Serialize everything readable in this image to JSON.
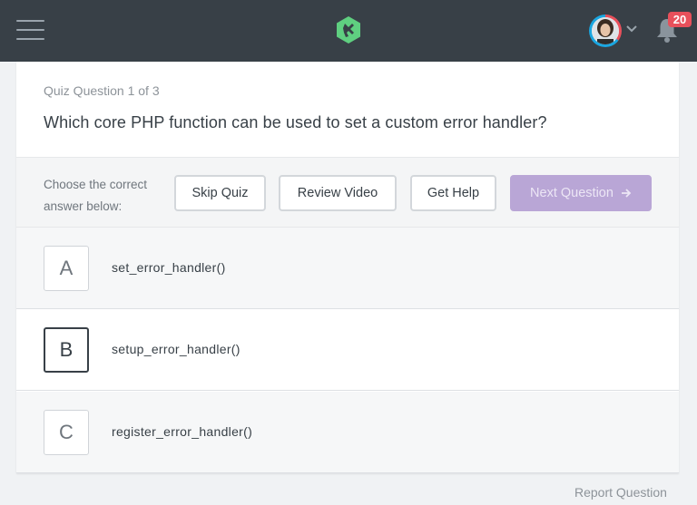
{
  "header": {
    "logo_icon": "treehouse-logo-icon",
    "menu_icon": "hamburger-menu-icon",
    "avatar_icon": "user-avatar",
    "chevron_icon": "chevron-down-icon",
    "bell_icon": "bell-icon",
    "notification_count": "20",
    "colors": {
      "bar": "#384047",
      "logo": "#5fcf80",
      "badge": "#e8505b"
    }
  },
  "quiz": {
    "progress_label": "Quiz Question 1 of 3",
    "question": "Which core PHP function can be used to set a custom error handler?"
  },
  "actions": {
    "prompt": "Choose the correct answer below:",
    "skip_label": "Skip Quiz",
    "review_label": "Review Video",
    "help_label": "Get Help",
    "next_label": "Next Question",
    "next_icon": "arrow-right-icon",
    "next_color": "#b9a6d6"
  },
  "answers": [
    {
      "letter": "A",
      "text": "set_error_handler()"
    },
    {
      "letter": "B",
      "text": "setup_error_handler()"
    },
    {
      "letter": "C",
      "text": "register_error_handler()"
    }
  ],
  "footer": {
    "report_label": "Report Question"
  }
}
